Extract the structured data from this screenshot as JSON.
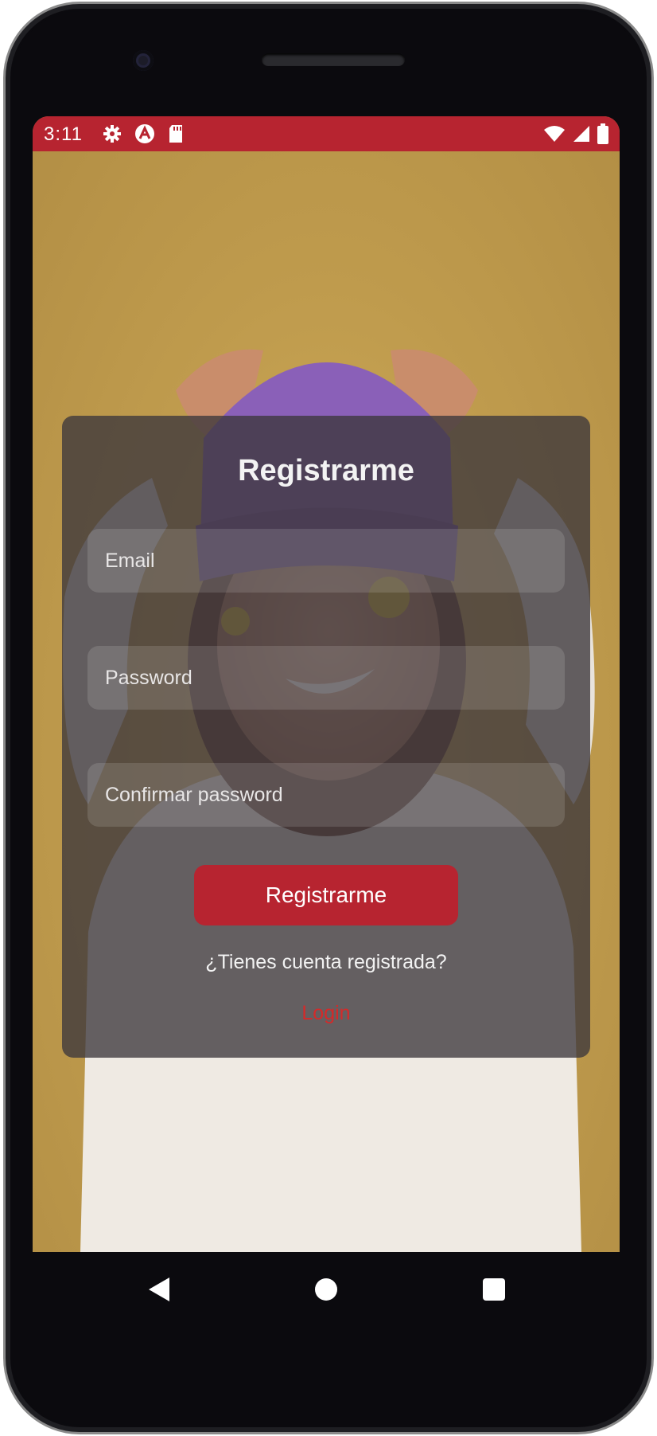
{
  "status_bar": {
    "time": "3:11",
    "icons_left": [
      "gear-icon",
      "a-icon",
      "sd-card-icon"
    ],
    "icons_right": [
      "wifi-icon",
      "signal-icon",
      "battery-icon"
    ],
    "color": "#b72430"
  },
  "register_card": {
    "title": "Registrarme",
    "email_placeholder": "Email",
    "password_placeholder": "Password",
    "confirm_placeholder": "Confirmar password",
    "submit_label": "Registrarme",
    "question": "¿Tienes cuenta registrada?",
    "login_link": "Login"
  },
  "colors": {
    "accent": "#b72430",
    "background": "#c09d4f",
    "card": "#3c373c",
    "link": "#d42a2a"
  },
  "nav_bar": {
    "buttons": [
      "back-icon",
      "home-icon",
      "recents-icon"
    ]
  }
}
